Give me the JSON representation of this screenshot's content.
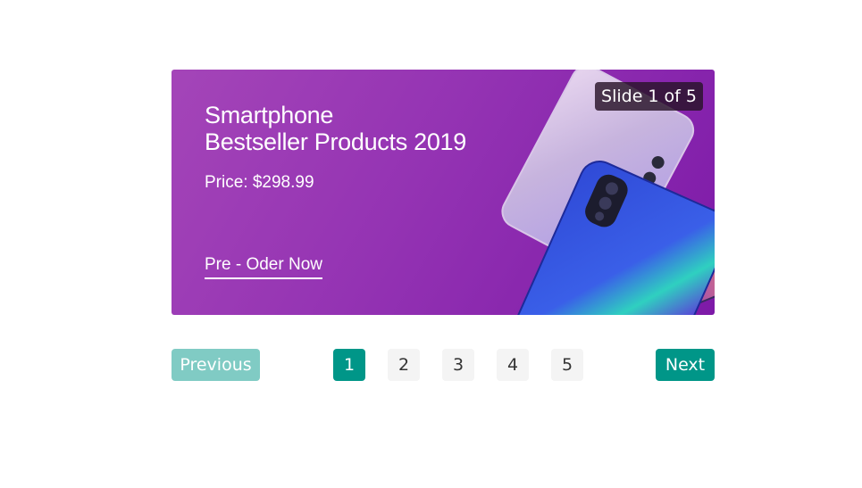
{
  "slide": {
    "headline_line1": "Smartphone",
    "headline_line2": "Bestseller Products 2019",
    "price": "Price: $298.99",
    "cta": "Pre - Oder Now",
    "counter": "Slide 1 of 5"
  },
  "pager": {
    "previous": "Previous",
    "next": "Next",
    "pages": [
      "1",
      "2",
      "3",
      "4",
      "5"
    ],
    "active_page": "1"
  },
  "colors": {
    "accent": "#009688",
    "accent_disabled": "#80cbc4",
    "banner_purple": "#9433b3"
  }
}
